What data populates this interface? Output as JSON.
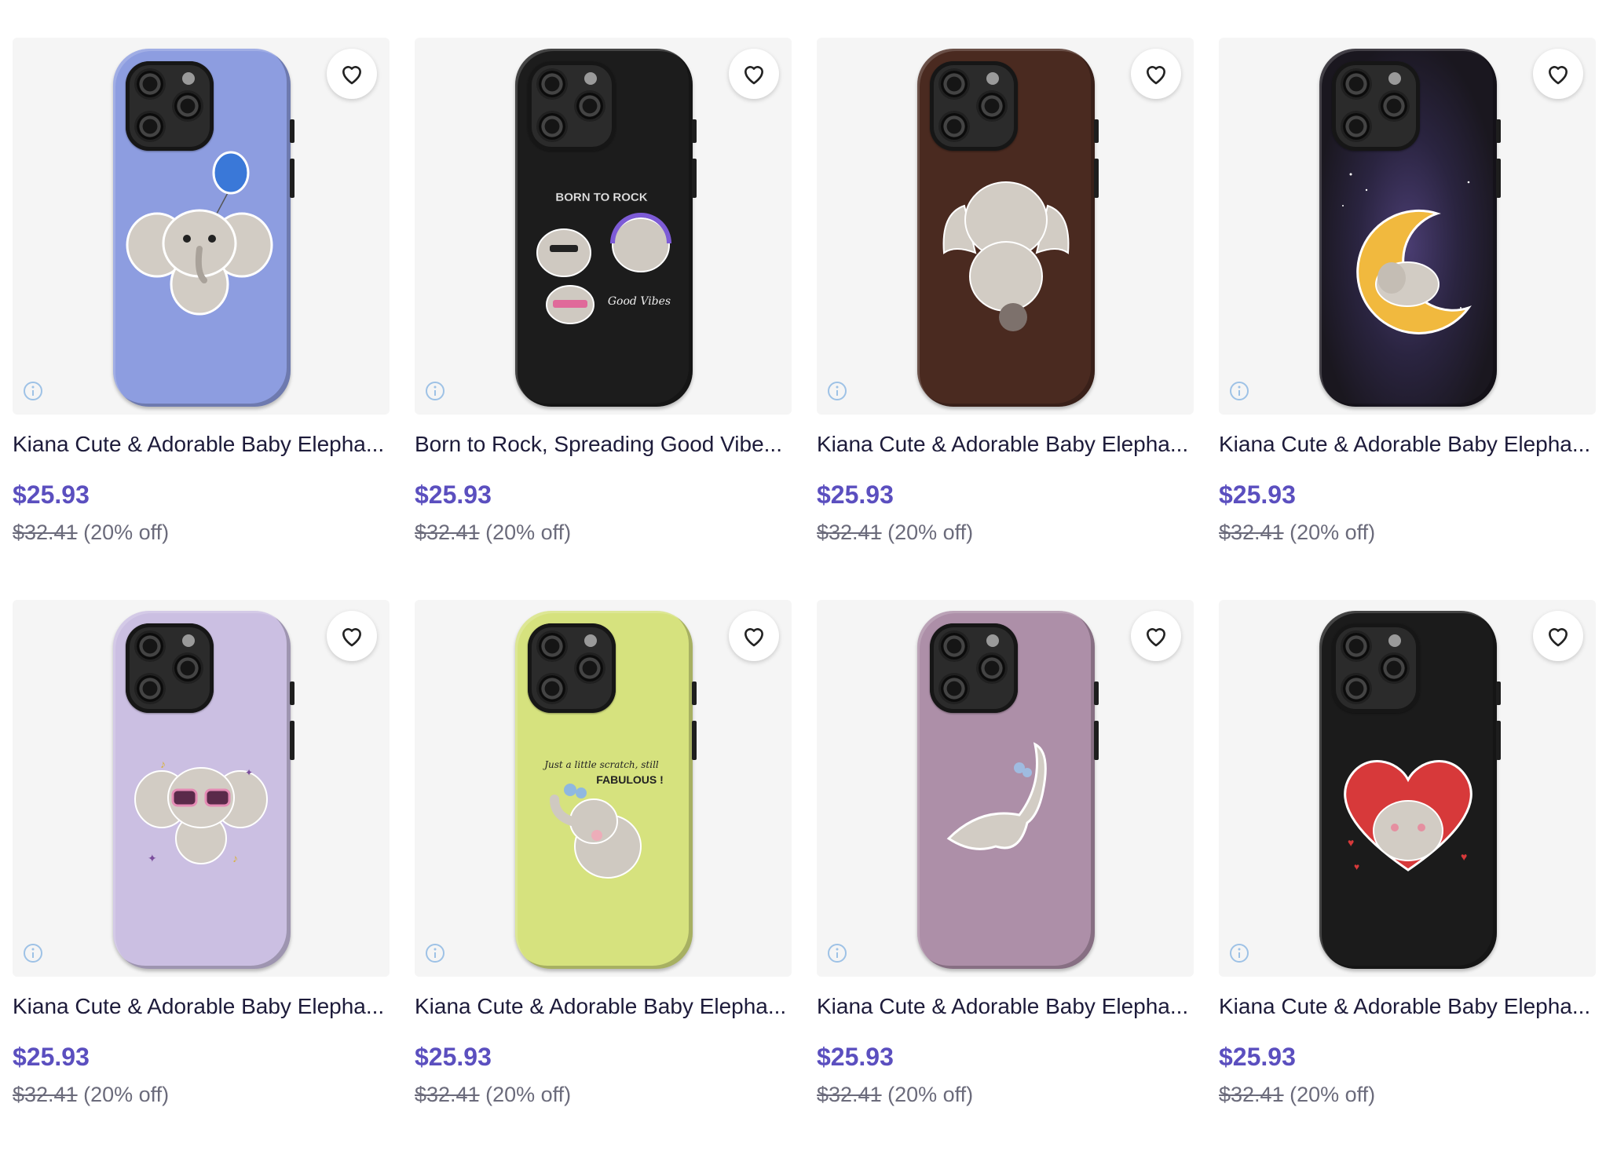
{
  "products": [
    {
      "title": "Kiana Cute & Adorable Baby Elepha...",
      "price": "$25.93",
      "original_price": "$32.41",
      "discount": "(20% off)",
      "case_color": "#8d9de0",
      "design": "elephant-with-blue-balloon"
    },
    {
      "title": "Born to Rock, Spreading Good Vibe...",
      "price": "$25.93",
      "original_price": "$32.41",
      "discount": "(20% off)",
      "case_color": "#1c1c1c",
      "design": "born-to-rock-elephants",
      "art_text": [
        "BORN TO ROCK",
        "Good Vibes"
      ]
    },
    {
      "title": "Kiana Cute & Adorable Baby Elepha...",
      "price": "$25.93",
      "original_price": "$32.41",
      "discount": "(20% off)",
      "case_color": "#4a2a20",
      "design": "elephant-back-view"
    },
    {
      "title": "Kiana Cute & Adorable Baby Elepha...",
      "price": "$25.93",
      "original_price": "$32.41",
      "discount": "(20% off)",
      "case_color": "#1e1b22",
      "design": "elephant-sleeping-on-moon"
    },
    {
      "title": "Kiana Cute & Adorable Baby Elepha...",
      "price": "$25.93",
      "original_price": "$32.41",
      "discount": "(20% off)",
      "case_color": "#cbbfe2",
      "design": "elephant-with-sunglasses"
    },
    {
      "title": "Kiana Cute & Adorable Baby Elepha...",
      "price": "$25.93",
      "original_price": "$32.41",
      "discount": "(20% off)",
      "case_color": "#d6e27e",
      "design": "elephant-with-flowers",
      "art_text": [
        "Just a little scratch, still",
        "FABULOUS !"
      ]
    },
    {
      "title": "Kiana Cute & Adorable Baby Elepha...",
      "price": "$25.93",
      "original_price": "$32.41",
      "discount": "(20% off)",
      "case_color": "#ad8fa8",
      "design": "elephant-yoga-pose"
    },
    {
      "title": "Kiana Cute & Adorable Baby Elepha...",
      "price": "$25.93",
      "original_price": "$32.41",
      "discount": "(20% off)",
      "case_color": "#1b1b1b",
      "design": "elephant-with-red-heart"
    }
  ],
  "icons": {
    "favorite": "heart-outline-icon",
    "info": "info-circle-icon"
  },
  "colors": {
    "price": "#5b4fbf",
    "title": "#1d1b3a",
    "muted": "#6b6b7b",
    "thumb_bg": "#f5f5f5"
  }
}
